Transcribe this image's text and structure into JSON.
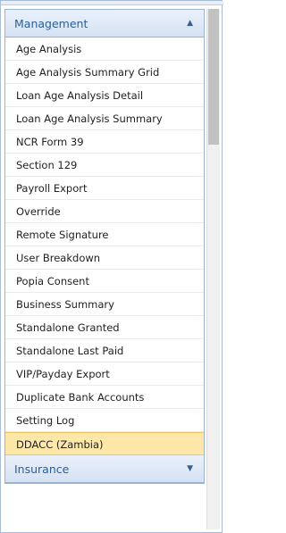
{
  "menu": {
    "management_header": "Management",
    "insurance_header": "Insurance",
    "items": [
      "Age Analysis",
      "Age Analysis Summary Grid",
      "Loan Age Analysis Detail",
      "Loan Age Analysis Summary",
      "NCR Form 39",
      "Section 129",
      "Payroll Export",
      "Override",
      "Remote Signature",
      "User Breakdown",
      "Popia Consent",
      "Business Summary",
      "Standalone Granted",
      "Standalone Last Paid",
      "VIP/Payday Export",
      "Duplicate Bank Accounts",
      "Setting Log",
      "DDACC (Zambia)"
    ],
    "selected_item": "DDACC (Zambia)",
    "icons": {
      "collapse": "chevron-up-icon",
      "expand": "chevron-down-icon"
    },
    "colors": {
      "header_text": "#2b5f98",
      "selected_bg": "#fde8aa"
    }
  }
}
